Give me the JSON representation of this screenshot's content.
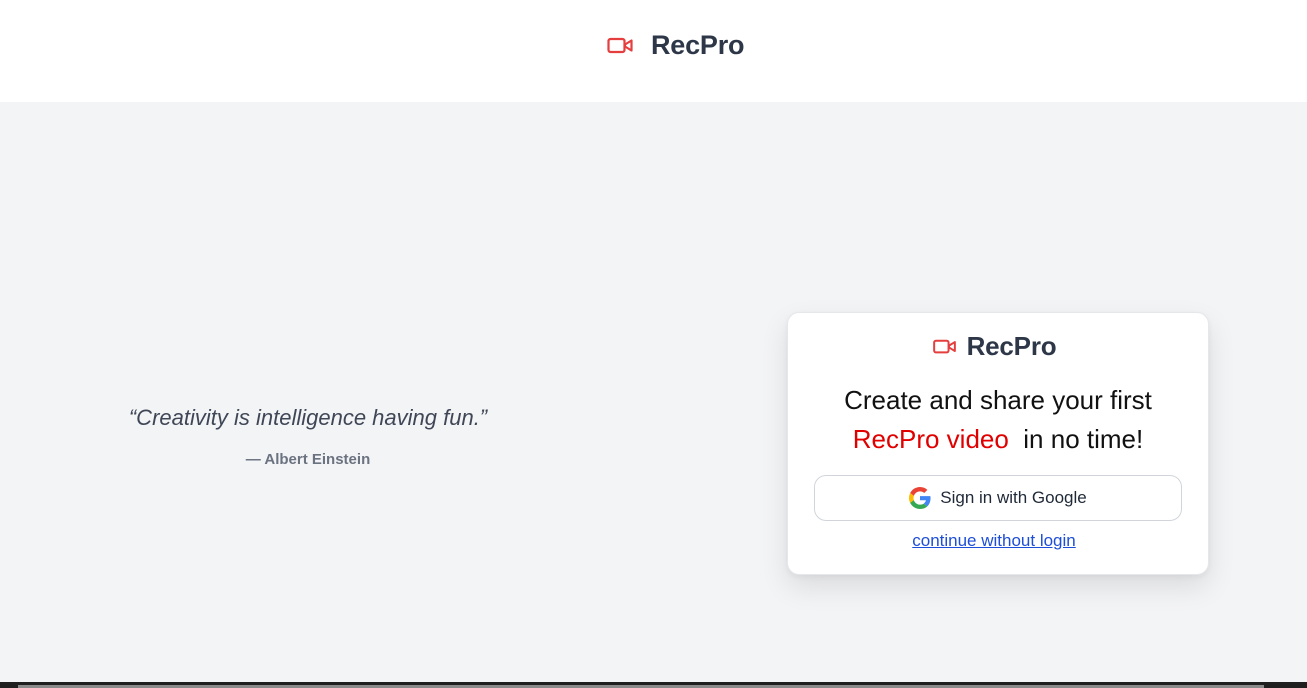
{
  "header": {
    "brand_icon": "video-camera-icon",
    "brand_name": "RecPro"
  },
  "quote": {
    "text": "“Creativity is intelligence having fun.”",
    "author": "— Albert Einstein"
  },
  "card": {
    "brand_icon": "video-camera-icon",
    "brand_name": "RecPro",
    "headline_line1": "Create and share your first",
    "headline_accent": "RecPro video",
    "headline_rest": "in no time!",
    "google_icon": "google-g-icon",
    "google_button_label": "Sign in with Google",
    "continue_link": "continue without login"
  },
  "colors": {
    "brand_red": "#e53e3e",
    "accent_red": "#e00000",
    "link_blue": "#1d4ed8",
    "background": "#f3f4f6"
  }
}
